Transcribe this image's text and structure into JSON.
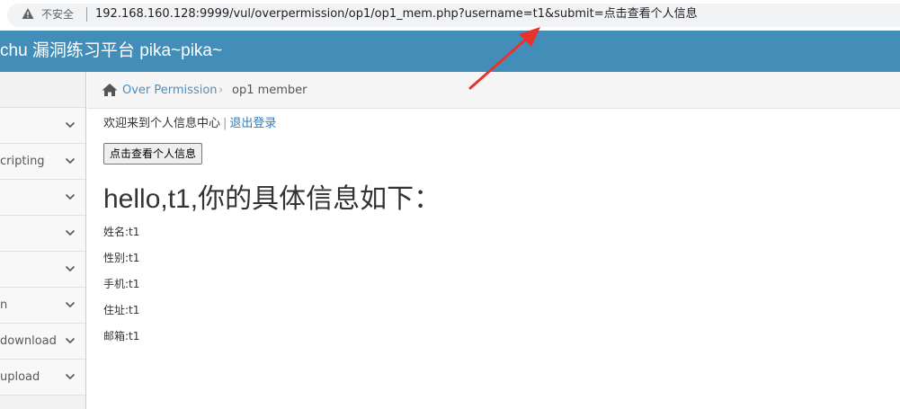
{
  "browser": {
    "insecure_label": "不安全",
    "url": "192.168.160.128:9999/vul/overpermission/op1/op1_mem.php?username=t1&submit=点击查看个人信息"
  },
  "header": {
    "title": "chu 漏洞练习平台 pika~pika~"
  },
  "sidebar": {
    "items": [
      {
        "label": ""
      },
      {
        "label": "cripting"
      },
      {
        "label": ""
      },
      {
        "label": ""
      },
      {
        "label": ""
      },
      {
        "label": "n"
      },
      {
        "label": "download"
      },
      {
        "label": "upload"
      }
    ]
  },
  "breadcrumb": {
    "parent": "Over Permission",
    "separator": "›",
    "current": "op1 member"
  },
  "main": {
    "welcome_text": "欢迎来到个人信息中心",
    "separator": "|",
    "logout_label": "退出登录",
    "view_button_label": "点击查看个人信息",
    "heading": "hello,t1,你的具体信息如下：",
    "info": [
      "姓名:t1",
      "性别:t1",
      "手机:t1",
      "住址:t1",
      "邮箱:t1"
    ]
  },
  "colors": {
    "header_bg": "#438eb9",
    "link": "#337ab7",
    "annotation_arrow": "#e8322c"
  }
}
